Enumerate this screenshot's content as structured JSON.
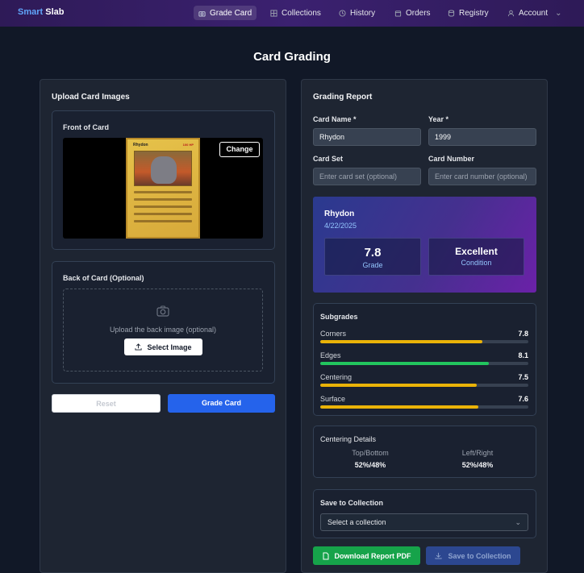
{
  "brand": {
    "part1": "Smart",
    "part2": "Slab"
  },
  "nav": {
    "items": [
      {
        "label": "Grade Card",
        "icon": "camera-icon",
        "active": true
      },
      {
        "label": "Collections",
        "icon": "grid-icon"
      },
      {
        "label": "History",
        "icon": "history-icon"
      },
      {
        "label": "Orders",
        "icon": "box-icon"
      },
      {
        "label": "Registry",
        "icon": "database-icon"
      },
      {
        "label": "Account",
        "icon": "user-icon",
        "chevron": "⌄"
      }
    ]
  },
  "page_title": "Card Grading",
  "upload": {
    "title": "Upload Card Images",
    "front_label": "Front of Card",
    "change_label": "Change",
    "back_label": "Back of Card (Optional)",
    "back_hint": "Upload the back image (optional)",
    "select_image_label": "Select Image",
    "reset_label": "Reset",
    "grade_label": "Grade Card"
  },
  "report": {
    "title": "Grading Report",
    "card_name_label": "Card Name *",
    "card_name_value": "Rhydon",
    "year_label": "Year *",
    "year_value": "1999",
    "card_set_label": "Card Set",
    "card_set_placeholder": "Enter card set (optional)",
    "card_number_label": "Card Number",
    "card_number_placeholder": "Enter card number (optional)",
    "hero": {
      "name": "Rhydon",
      "date": "4/22/2025",
      "grade": "7.8",
      "grade_label": "Grade",
      "condition": "Excellent",
      "condition_label": "Condition"
    },
    "subgrades_title": "Subgrades",
    "subgrades": [
      {
        "label": "Corners",
        "value": "7.8",
        "fraction": 0.78,
        "color": "#eab308"
      },
      {
        "label": "Edges",
        "value": "8.1",
        "fraction": 0.81,
        "color": "#22c55e"
      },
      {
        "label": "Centering",
        "value": "7.5",
        "fraction": 0.75,
        "color": "#eab308"
      },
      {
        "label": "Surface",
        "value": "7.6",
        "fraction": 0.76,
        "color": "#eab308"
      }
    ],
    "centering_title": "Centering Details",
    "top_bottom_label": "Top/Bottom",
    "top_bottom_value": "52%/48%",
    "left_right_label": "Left/Right",
    "left_right_value": "52%/48%",
    "save_title": "Save to Collection",
    "collection_select": "Select a collection",
    "download_label": "Download Report PDF",
    "save_label": "Save to Collection"
  },
  "card_preview": {
    "name": "Rhydon",
    "hp": "100 HP"
  }
}
